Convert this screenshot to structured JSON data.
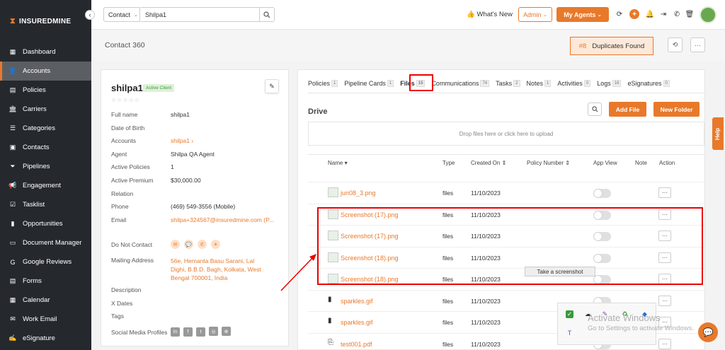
{
  "brand": {
    "logo_text": "INSUREDMINE",
    "accent": "#e8792b",
    "sidebar_bg": "#25292e"
  },
  "sidebar": {
    "items": [
      {
        "label": "Dashboard",
        "icon": "grid-icon",
        "glyph": "▦"
      },
      {
        "label": "Accounts",
        "icon": "user-icon",
        "glyph": "👤",
        "active": true
      },
      {
        "label": "Policies",
        "icon": "document-icon",
        "glyph": "▤"
      },
      {
        "label": "Carriers",
        "icon": "bank-icon",
        "glyph": "🏛"
      },
      {
        "label": "Categories",
        "icon": "list-icon",
        "glyph": "☰"
      },
      {
        "label": "Contacts",
        "icon": "contact-card-icon",
        "glyph": "▣"
      },
      {
        "label": "Pipelines",
        "icon": "funnel-icon",
        "glyph": "⏷"
      },
      {
        "label": "Engagement",
        "icon": "megaphone-icon",
        "glyph": "📢"
      },
      {
        "label": "Tasklist",
        "icon": "checklist-icon",
        "glyph": "☑"
      },
      {
        "label": "Opportunities",
        "icon": "bar-chart-icon",
        "glyph": "▮"
      },
      {
        "label": "Document Manager",
        "icon": "folder-icon",
        "glyph": "▭"
      },
      {
        "label": "Google Reviews",
        "icon": "google-icon",
        "glyph": "G"
      },
      {
        "label": "Forms",
        "icon": "form-icon",
        "glyph": "▤"
      },
      {
        "label": "Calendar",
        "icon": "calendar-icon",
        "glyph": "▦"
      },
      {
        "label": "Work Email",
        "icon": "mail-icon",
        "glyph": "✉"
      },
      {
        "label": "eSignature",
        "icon": "signature-icon",
        "glyph": "✍"
      }
    ]
  },
  "topbar": {
    "search_scope": "Contact",
    "search_value": "Shilpa1",
    "whats_new": "What's New",
    "admin": "Admin",
    "my_agents": "My Agents"
  },
  "header": {
    "title": "Contact 360",
    "duplicates_num": "#8",
    "duplicates_label": "Duplicates Found"
  },
  "contact": {
    "name": "shilpa1",
    "status": "Active Client",
    "stars": "☆☆☆☆☆",
    "fields": [
      {
        "label": "Full name",
        "value": "shilpa1"
      },
      {
        "label": "Date of Birth",
        "value": ""
      },
      {
        "label": "Accounts",
        "value": "shilpa1 ›",
        "link": true
      },
      {
        "label": "Agent",
        "value": "Shilpa QA Agent"
      },
      {
        "label": "Active Policies",
        "value": "1"
      },
      {
        "label": "Active Premium",
        "value": "$30,000.00"
      },
      {
        "label": "Relation",
        "value": ""
      },
      {
        "label": "Phone",
        "value": "(469) 549-3556 (Mobile)"
      },
      {
        "label": "Email",
        "value": "shilpa+324567@insuredmine.com  (P...",
        "link": true
      }
    ],
    "do_not_contact_label": "Do Not Contact",
    "mailing_label": "Mailing Address",
    "mailing_lines": [
      "56e, Hemanta Basu Sarani, Lal",
      "Dighi, B.B.D. Bagh, Kolkata, West",
      "Bengal 700001, India"
    ],
    "description_label": "Description",
    "xdates_label": "X Dates",
    "tags_label": "Tags",
    "social_label": "Social Media Profiles"
  },
  "tabs": [
    {
      "label": "Policies",
      "count": "1"
    },
    {
      "label": "Pipeline Cards",
      "count": "1"
    },
    {
      "label": "Files",
      "count": "15",
      "active": true
    },
    {
      "label": "Communications",
      "count": "74"
    },
    {
      "label": "Tasks",
      "count": "2"
    },
    {
      "label": "Notes",
      "count": "1"
    },
    {
      "label": "Activities",
      "count": "0"
    },
    {
      "label": "Logs",
      "count": "16"
    },
    {
      "label": "eSignatures",
      "count": "0"
    }
  ],
  "drive": {
    "title": "Drive",
    "add_file": "Add File",
    "new_folder": "New Folder",
    "dropzone": "Drop files here or click here to upload",
    "columns": [
      "Name",
      "Type",
      "Created On",
      "Policy Number",
      "App View",
      "Note",
      "Action"
    ],
    "rows": [
      {
        "name": "jun08_3.png",
        "type": "files",
        "date": "11/10/2023",
        "kind": "image"
      },
      {
        "name": "Screenshot (17).png",
        "type": "files",
        "date": "11/10/2023",
        "kind": "image"
      },
      {
        "name": "Screenshot (17).png",
        "type": "files",
        "date": "11/10/2023",
        "kind": "image"
      },
      {
        "name": "Screenshot (18).png",
        "type": "files",
        "date": "11/10/2023",
        "kind": "image"
      },
      {
        "name": "Screenshot (18).png",
        "type": "files",
        "date": "11/10/2023",
        "kind": "image"
      },
      {
        "name": "sparkles.gif",
        "type": "files",
        "date": "11/10/2023",
        "kind": "file"
      },
      {
        "name": "sparkles.gif",
        "type": "files",
        "date": "11/10/2023",
        "kind": "file"
      },
      {
        "name": "test001.pdf",
        "type": "files",
        "date": "11/10/2023",
        "kind": "pdf"
      }
    ],
    "tooltip": "Take a screenshot"
  },
  "overlay": {
    "help": "Help",
    "win_line1": "Activate Windows",
    "win_line2": "Go to Settings to activate Windows."
  }
}
